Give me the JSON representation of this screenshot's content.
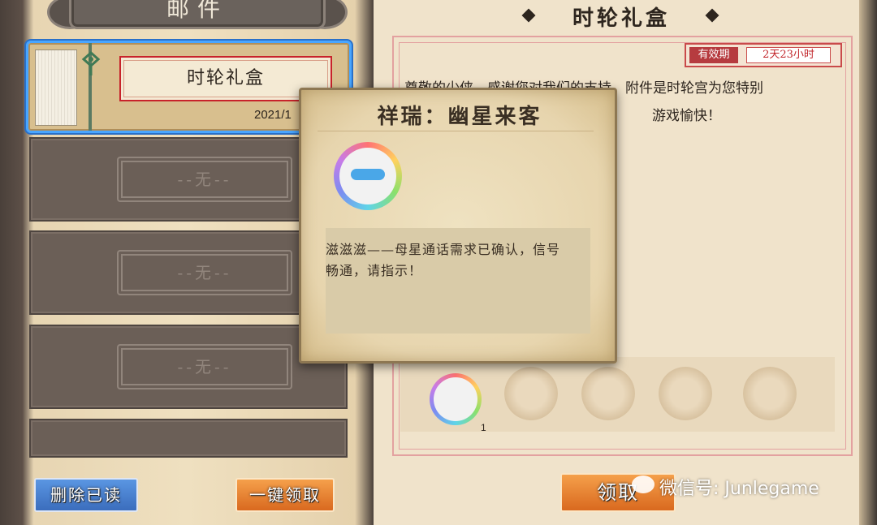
{
  "left_panel": {
    "title": "邮件",
    "mails": [
      {
        "title": "时轮礼盒",
        "date": "2021/1",
        "selected": true
      },
      {
        "title": "--无--"
      },
      {
        "title": "--无--"
      },
      {
        "title": "--无--"
      }
    ],
    "delete_read_label": "删除已读",
    "claim_all_label": "一键领取"
  },
  "detail": {
    "title": "时轮礼盒",
    "validity_label": "有效期",
    "validity_value": "2天23小时",
    "letter_line1": "尊敬的少侠，感谢您对我们的支持，附件是时轮宫为您特别",
    "letter_line2": "游戏愉快！",
    "attachments": [
      {
        "icon": "alien-cat-avatar-icon",
        "count": "1"
      }
    ],
    "claim_label": "领取"
  },
  "popup": {
    "title": "祥瑞：幽星来客",
    "icon": "alien-cat-avatar-icon",
    "description": "滋滋滋——母星通话需求已确认，信号畅通，请指示！"
  },
  "watermark": "微信号: Junlegame",
  "colors": {
    "selection_blue": "#49a6ff",
    "accent_red": "#c8232b",
    "button_orange": "#e8822f",
    "button_blue": "#4a82d0"
  }
}
